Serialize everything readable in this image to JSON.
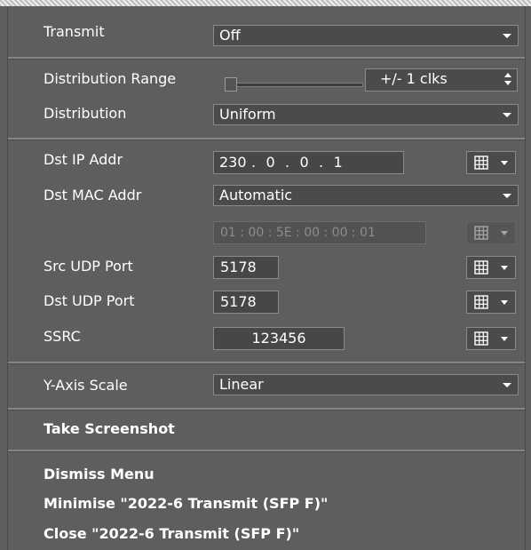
{
  "transmit": {
    "label": "Transmit",
    "value": "Off"
  },
  "distribution_range": {
    "label": "Distribution Range",
    "value": "+/- 1 clks",
    "slider_position": 0
  },
  "distribution": {
    "label": "Distribution",
    "value": "Uniform"
  },
  "dst_ip": {
    "label": "Dst IP Addr",
    "octets": [
      "230",
      "0",
      "0",
      "1"
    ],
    "separator": "."
  },
  "dst_mac": {
    "label": "Dst MAC Addr",
    "mode": "Automatic",
    "address": "01 : 00 : 5E : 00 : 00 : 01"
  },
  "src_udp": {
    "label": "Src UDP Port",
    "value": "5178"
  },
  "dst_udp": {
    "label": "Dst UDP Port",
    "value": "5178"
  },
  "ssrc": {
    "label": "SSRC",
    "value": "123456"
  },
  "y_axis": {
    "label": "Y-Axis Scale",
    "value": "Linear"
  },
  "menu": {
    "take_screenshot": "Take Screenshot",
    "dismiss": "Dismiss Menu",
    "minimise": "Minimise \"2022-6 Transmit (SFP F)\"",
    "close": "Close \"2022-6 Transmit (SFP F)\""
  },
  "icons": {
    "picker": "grid-icon",
    "dropdown": "chevron-down-icon",
    "spin": "spin-arrows-icon"
  },
  "colors": {
    "panel": "#5e5e5e",
    "field": "#4b4b4b",
    "border": "#8a8a8a",
    "text": "#ffffff",
    "disabled_text": "#8c8c8c"
  }
}
